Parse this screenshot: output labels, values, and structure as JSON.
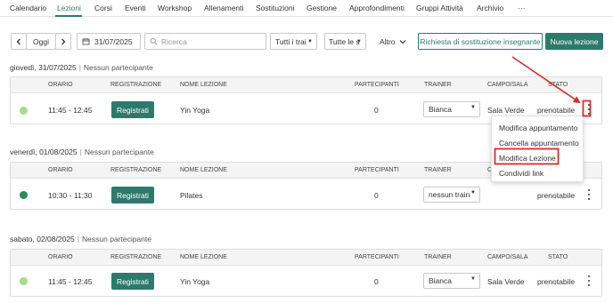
{
  "nav": {
    "items": [
      "Calendario",
      "Lezioni",
      "Corsi",
      "Eventi",
      "Workshop",
      "Allenamenti",
      "Sostituzioni",
      "Gestione",
      "Approfondimenti",
      "Gruppi Attività",
      "Archivio",
      "···"
    ],
    "active": "Lezioni"
  },
  "toolbar": {
    "prev_icon": "chevron-left",
    "today_label": "Oggi",
    "next_icon": "chevron-right",
    "date_value": "31/07/2025",
    "search_placeholder": "Ricerca",
    "filter1": "Tutti i trai",
    "filter2": "Tutte le s",
    "more_label": "Altro",
    "substitute_label": "Richiesta di sostituzione insegnante",
    "new_lesson_label": "Nuova lezione"
  },
  "columns": {
    "time": "ORARIO",
    "registration": "REGISTRAZIONE",
    "name": "NOME LEZIONE",
    "participants": "PARTECIPANTI",
    "trainer": "TRAINER",
    "room": "CAMPO/SALA",
    "status": "STATO"
  },
  "no_participants": "Nessun partecipante",
  "days": [
    {
      "date": "giovedì, 31/07/2025",
      "time": "11:45 - 12:45",
      "register": "Registrati",
      "name": "Yin Yoga",
      "participants": "0",
      "trainer": "Bianca",
      "room": "Sala Verde",
      "status": "prenotabile",
      "dot_color": "#a4dc8c"
    },
    {
      "date": "venerdì, 01/08/2025",
      "time": "10:30 - 11:30",
      "register": "Registrati",
      "name": "Pilates",
      "participants": "0",
      "trainer": "nessun train",
      "room": "",
      "status": "prenotabile",
      "dot_color": "#2b8a5c"
    },
    {
      "date": "sabato, 02/08/2025",
      "time": "11:45 - 12:45",
      "register": "Registrati",
      "name": "Yin Yoga",
      "participants": "0",
      "trainer": "Bianca",
      "room": "Sala Verde",
      "status": "prenotabile",
      "dot_color": "#a4dc8c"
    }
  ],
  "menu": {
    "items": [
      "Modifica appuntamento",
      "Cancella appuntamento",
      "Modifica Lezione",
      "Condividi link"
    ],
    "highlighted": "Modifica Lezione"
  },
  "colors": {
    "accent": "#2b7a6b",
    "annotation": "#d92b2b"
  }
}
